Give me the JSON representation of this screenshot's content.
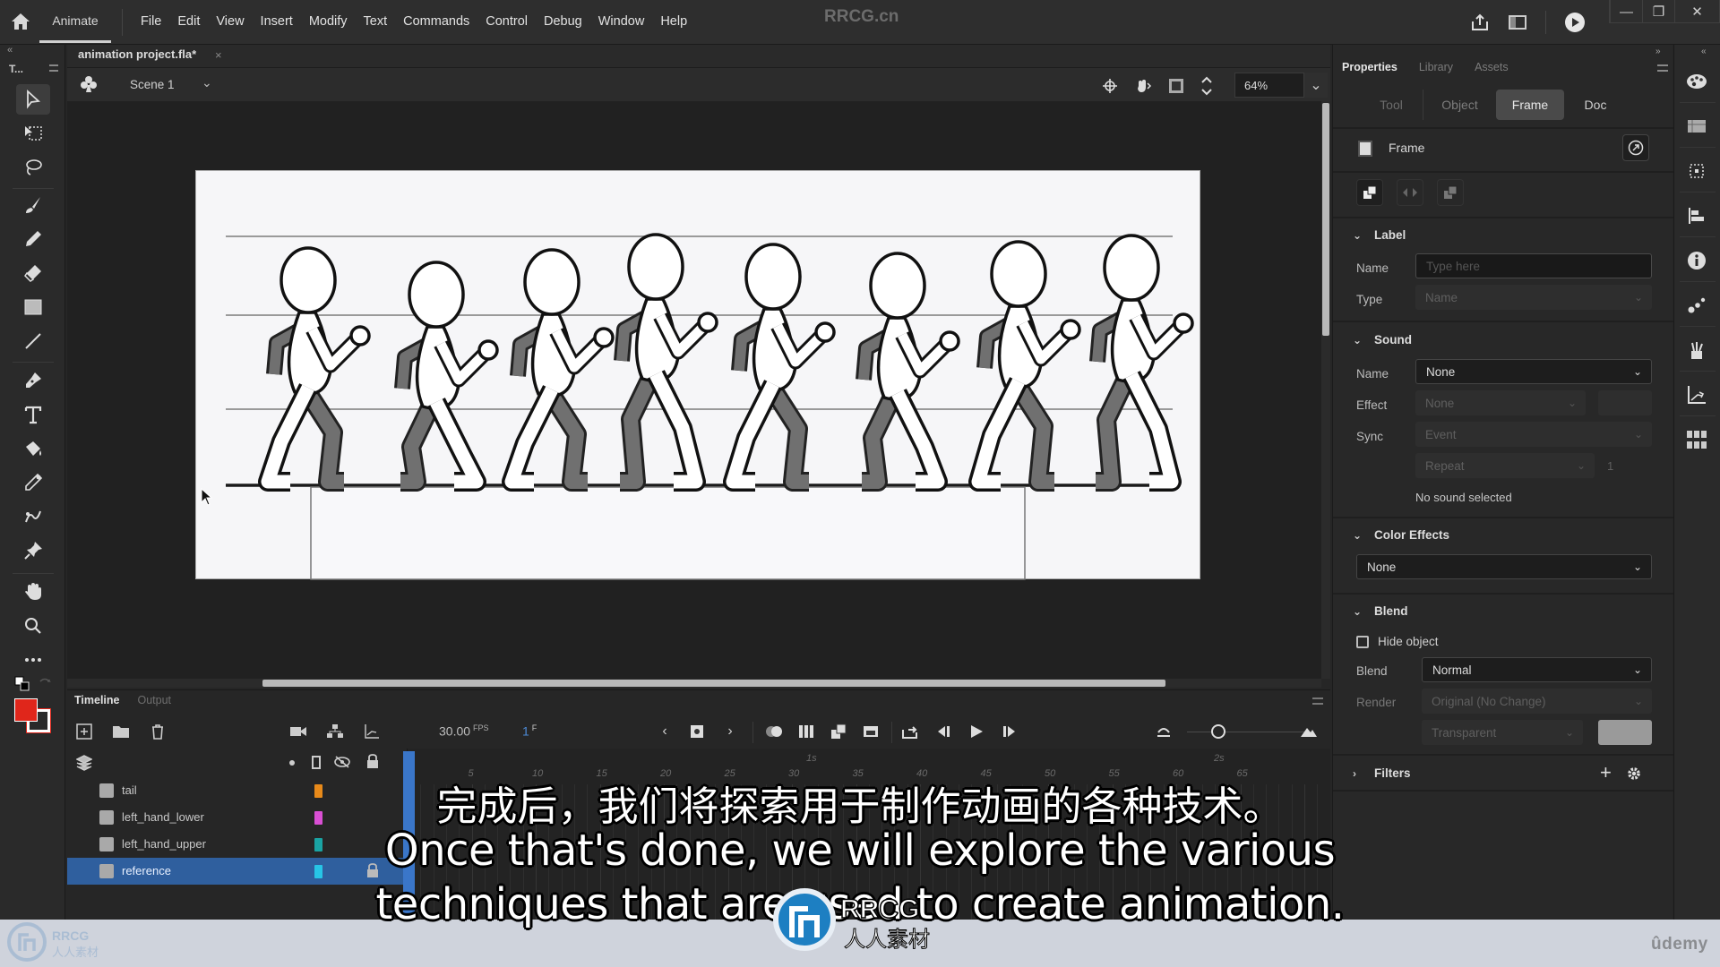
{
  "menubar": {
    "app_tab": "Animate",
    "items": [
      "File",
      "Edit",
      "View",
      "Insert",
      "Modify",
      "Text",
      "Commands",
      "Control",
      "Debug",
      "Window",
      "Help"
    ],
    "site_title": "RRCG.cn",
    "icons": [
      "share-icon",
      "workspace-icon",
      "test-movie-icon"
    ],
    "window_controls": [
      "minimize",
      "restore",
      "close"
    ]
  },
  "toolbar": {
    "title": "T...",
    "collapse": "«",
    "tools": [
      {
        "name": "selection-tool",
        "active": true
      },
      {
        "name": "free-transform-tool"
      },
      {
        "name": "lasso-tool"
      },
      {
        "name": "paint-brush-tool"
      },
      {
        "name": "pencil-tool"
      },
      {
        "name": "eraser-tool"
      },
      {
        "name": "rectangle-tool"
      },
      {
        "name": "line-tool"
      },
      {
        "name": "pen-tool"
      },
      {
        "name": "text-tool"
      },
      {
        "name": "paint-bucket-tool"
      },
      {
        "name": "eyedropper-tool"
      },
      {
        "name": "bone-tool"
      },
      {
        "name": "asset-warp-tool"
      },
      {
        "name": "hand-tool"
      },
      {
        "name": "zoom-tool"
      },
      {
        "name": "more-tools"
      }
    ],
    "stroke_color": "#ffffff",
    "fill_color": "#e0261b"
  },
  "document": {
    "tab_label": "animation project.fla*",
    "close": "×",
    "scene_label": "Scene 1",
    "zoom": "64%"
  },
  "timeline": {
    "tabs": [
      {
        "label": "Timeline",
        "active": true
      },
      {
        "label": "Output",
        "active": false
      }
    ],
    "fps_value": "30.00",
    "fps_unit": "FPS",
    "current_frame": "1",
    "frame_unit": "F",
    "ruler_seconds": [
      "1s",
      "2s"
    ],
    "ruler_frames": [
      "5",
      "10",
      "15",
      "20",
      "25",
      "30",
      "35",
      "40",
      "45",
      "50",
      "55",
      "60",
      "65"
    ],
    "layers": [
      {
        "name": "tail",
        "color": "#e88a1a",
        "selected": false,
        "locked": false
      },
      {
        "name": "left_hand_lower",
        "color": "#d94fd3",
        "selected": false,
        "locked": false
      },
      {
        "name": "left_hand_upper",
        "color": "#1aa3a3",
        "selected": false,
        "locked": false
      },
      {
        "name": "reference",
        "color": "#27c5e6",
        "selected": true,
        "locked": true
      }
    ]
  },
  "properties": {
    "tabs": [
      {
        "label": "Properties",
        "active": true
      },
      {
        "label": "Library",
        "active": false
      },
      {
        "label": "Assets",
        "active": false
      }
    ],
    "segments": [
      {
        "label": "Tool",
        "active": false
      },
      {
        "label": "Object",
        "active": false
      },
      {
        "label": "Frame",
        "active": true
      },
      {
        "label": "Doc",
        "active": false
      }
    ],
    "header": "Frame",
    "label_section": {
      "title": "Label",
      "name_label": "Name",
      "name_placeholder": "Type here",
      "type_label": "Type",
      "type_value": "Name"
    },
    "sound_section": {
      "title": "Sound",
      "name_label": "Name",
      "name_value": "None",
      "effect_label": "Effect",
      "effect_value": "None",
      "sync_label": "Sync",
      "sync_value": "Event",
      "repeat_value": "Repeat",
      "repeat_count": "1",
      "status": "No sound selected"
    },
    "color_effects": {
      "title": "Color Effects",
      "value": "None"
    },
    "blend_section": {
      "title": "Blend",
      "hide_object_label": "Hide object",
      "hide_object_checked": false,
      "blend_label": "Blend",
      "blend_value": "Normal",
      "render_label": "Render",
      "render_value": "Original (No Change)",
      "bg_value": "Transparent"
    },
    "filters": {
      "title": "Filters",
      "add": "+"
    }
  },
  "subtitles": {
    "chinese": "完成后，我们将探索用于制作动画的各种技术。",
    "english_line1": "Once that's done, we will explore the various",
    "english_line2": "techniques that are used to create animation."
  },
  "branding": {
    "udemy": "ûdemy",
    "watermark": "RRCG 人人素材"
  }
}
